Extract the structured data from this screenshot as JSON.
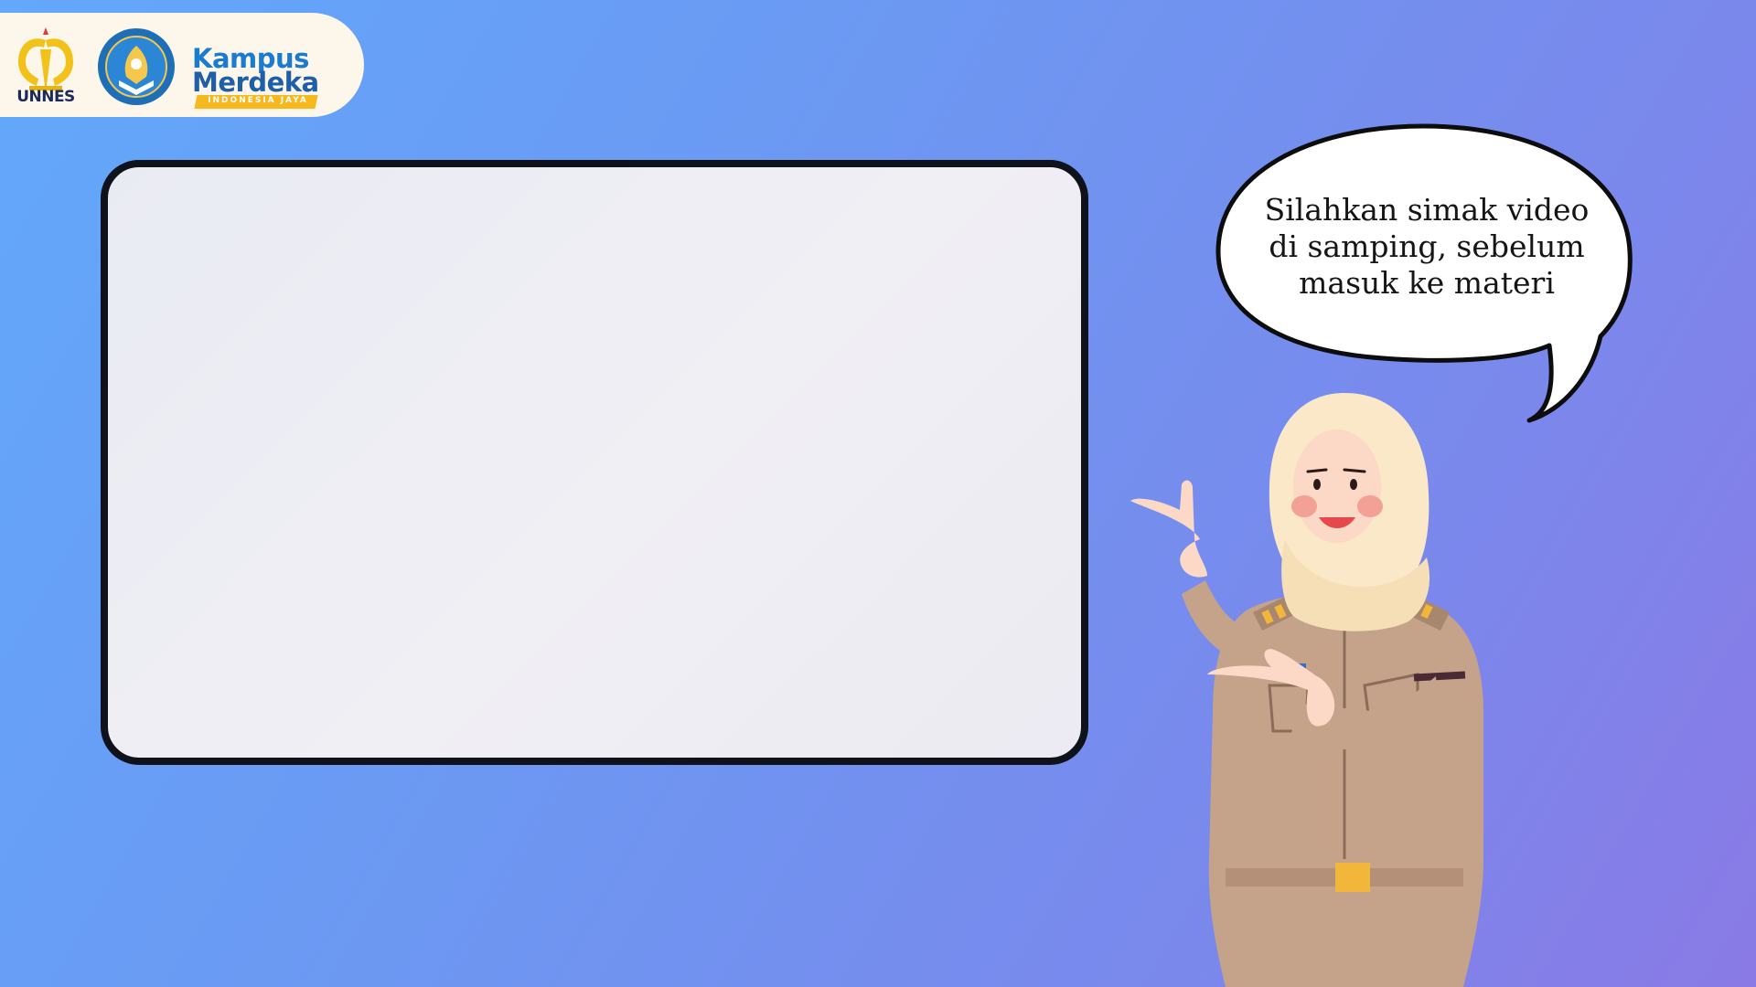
{
  "logos": {
    "unnes_label": "UNNES",
    "kampus_merdeka_line1": "Kampus",
    "kampus_merdeka_line2": "Merdeka",
    "kampus_merdeka_ribbon": "INDONESIA JAYA",
    "unnes_icon": "unnes-logo",
    "tutwuri_icon": "tut-wuri-handayani-logo"
  },
  "video": {
    "placeholder_icon": "video-frame"
  },
  "speech": {
    "line1": "Silahkan simak video",
    "line2": "di samping, sebelum",
    "line3": "masuk ke materi"
  },
  "colors": {
    "background_start": "#62a8fb",
    "background_end": "#8a7ae6",
    "frame_border": "#0f121b",
    "uniform": "#c4a38a",
    "hijab": "#fbe8c8"
  }
}
